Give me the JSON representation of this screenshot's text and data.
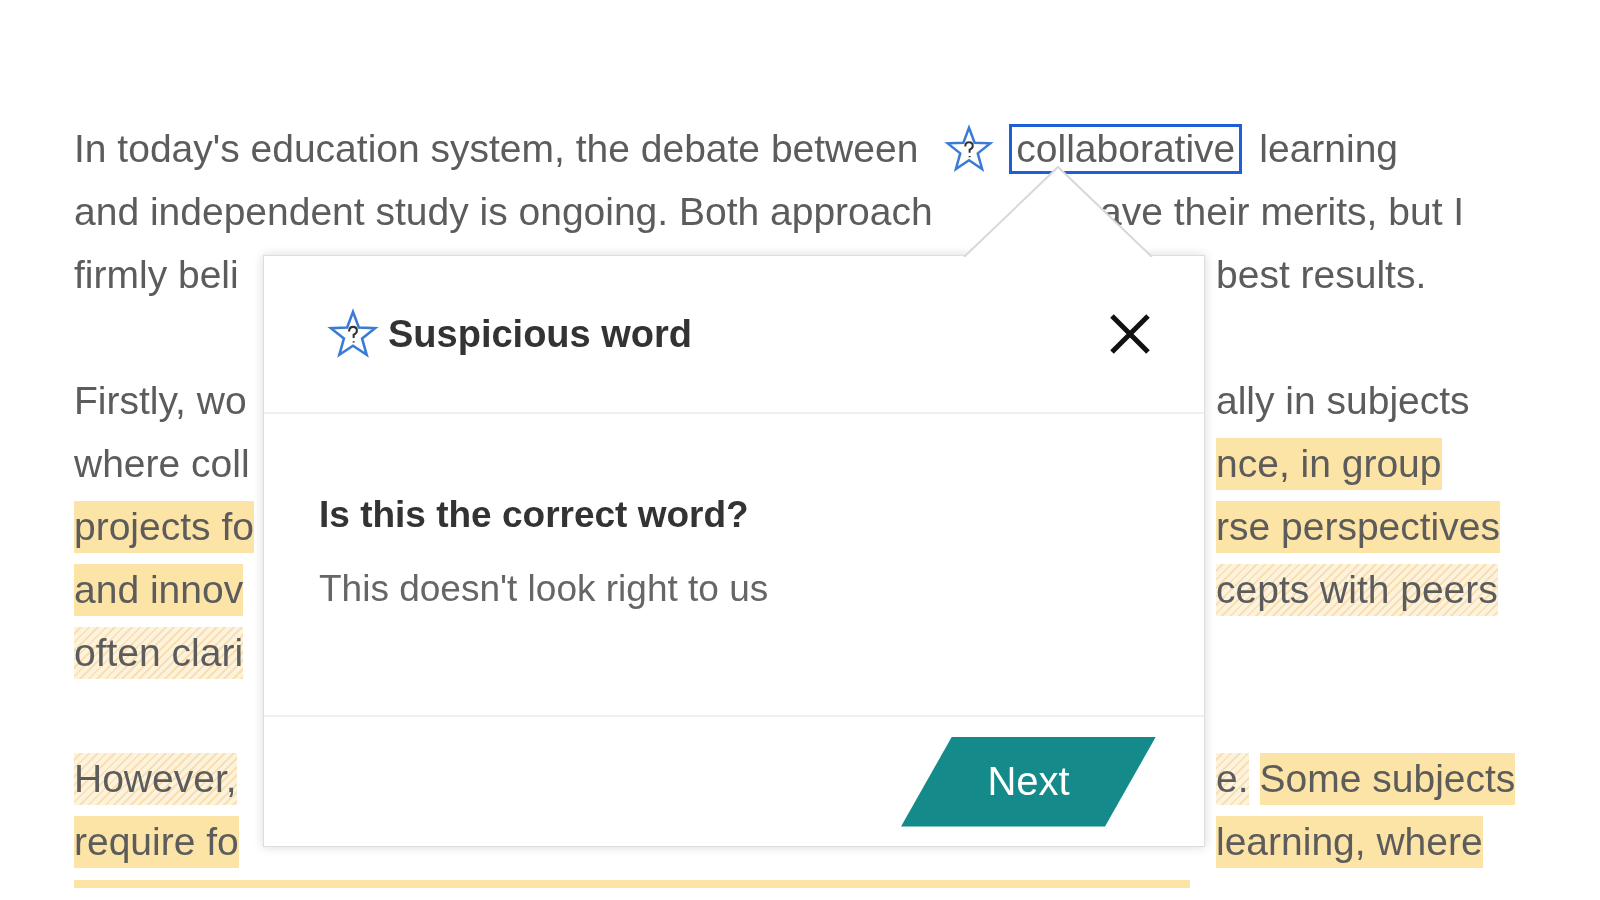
{
  "essay": {
    "paragraphs": [
      {
        "lines": [
          {
            "left": [
              {
                "kind": "text",
                "text": "In today's education system, the debate between",
                "highlighted": false,
                "hatched": false
              },
              {
                "kind": "flagged",
                "text": "collaborative",
                "highlighted": false,
                "hatched": false
              },
              {
                "kind": "text",
                "text": "learning",
                "highlighted": false,
                "hatched": false
              }
            ]
          },
          {
            "left": [
              {
                "kind": "text",
                "text": "and independent study is ongoing. Both approach",
                "highlighted": false,
                "hatched": false
              }
            ],
            "right": [
              {
                "kind": "text",
                "text": "ave their merits, but I",
                "highlighted": false,
                "hatched": false
              }
            ]
          },
          {
            "left": [
              {
                "kind": "text",
                "text": "firmly beli",
                "highlighted": false,
                "hatched": false
              }
            ],
            "right": [
              {
                "kind": "text",
                "text": "best results.",
                "highlighted": false,
                "hatched": false
              }
            ]
          }
        ]
      },
      {
        "lines": [
          {
            "left": [
              {
                "kind": "text",
                "text": "Firstly, wo",
                "highlighted": false,
                "hatched": false
              }
            ],
            "right": [
              {
                "kind": "text",
                "text": "ally in subjects",
                "highlighted": false,
                "hatched": false
              }
            ]
          },
          {
            "left": [
              {
                "kind": "text",
                "text": "where coll",
                "highlighted": false,
                "hatched": false
              }
            ],
            "right": [
              {
                "kind": "text",
                "text": "nce, in group",
                "highlighted": true,
                "hatched": false
              }
            ]
          },
          {
            "left": [
              {
                "kind": "text",
                "text": "projects fo",
                "highlighted": true,
                "hatched": false
              }
            ],
            "right": [
              {
                "kind": "text",
                "text": "rse perspectives",
                "highlighted": true,
                "hatched": false
              }
            ]
          },
          {
            "left": [
              {
                "kind": "text",
                "text": "and innov",
                "highlighted": true,
                "hatched": false
              }
            ],
            "right": [
              {
                "kind": "text",
                "text": "cepts with peers",
                "highlighted": false,
                "hatched": true
              }
            ]
          },
          {
            "left": [
              {
                "kind": "text",
                "text": "often clari",
                "highlighted": false,
                "hatched": true
              }
            ]
          }
        ]
      },
      {
        "lines": [
          {
            "left": [
              {
                "kind": "text",
                "text": "However,",
                "highlighted": false,
                "hatched": true
              }
            ],
            "right": [
              {
                "kind": "text",
                "text": "e.",
                "highlighted": false,
                "hatched": true
              },
              {
                "kind": "text",
                "text": "Some subjects",
                "highlighted": true,
                "hatched": false
              }
            ]
          },
          {
            "left": [
              {
                "kind": "text",
                "text": "require fo",
                "highlighted": true,
                "hatched": false
              }
            ],
            "right": [
              {
                "kind": "text",
                "text": "learning, where",
                "highlighted": true,
                "hatched": false
              }
            ]
          }
        ]
      }
    ]
  },
  "popup": {
    "title": "Suspicious word",
    "question": "Is this the correct word?",
    "message": "This doesn't look right to us",
    "button": "Next"
  }
}
